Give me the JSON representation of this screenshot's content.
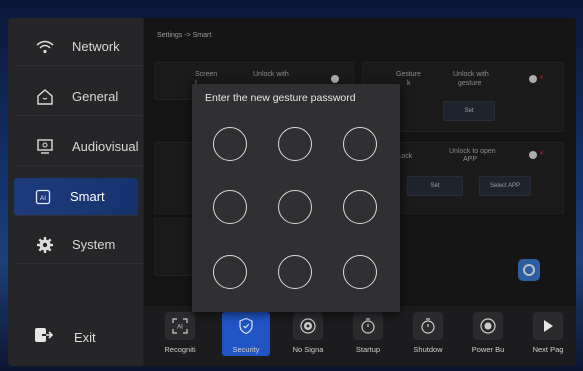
{
  "sidebar": {
    "items": [
      {
        "label": "Network",
        "icon": "wifi-icon"
      },
      {
        "label": "General",
        "icon": "home-icon"
      },
      {
        "label": "Audiovisual",
        "icon": "monitor-icon"
      },
      {
        "label": "Smart",
        "icon": "ai-icon",
        "active": true
      },
      {
        "label": "System",
        "icon": "gear-icon"
      }
    ],
    "exit_label": "Exit"
  },
  "main": {
    "breadcrumb": "Settings -> Smart",
    "screen_lock": {
      "label_a": "Screen",
      "label_b": "L",
      "option": "Unlock with"
    },
    "gesture_lock": {
      "label_a": "Gesture",
      "label_b": "k",
      "option_a": "Unlock with",
      "option_b": "gesture",
      "set_label": "Set"
    },
    "left_card_b": {
      "label": "L"
    },
    "left_card_c": {
      "label_a": "T",
      "label_b": "L"
    },
    "app_lock": {
      "label": "P Lock",
      "option_a": "Unlock to open",
      "option_b": "APP",
      "set_label": "Set",
      "select_label": "Select APP"
    }
  },
  "toolbar": {
    "items": [
      {
        "label": "Recogniti",
        "icon": "ai-scan-icon"
      },
      {
        "label": "Security",
        "icon": "shield-icon",
        "active": true
      },
      {
        "label": "No Signa",
        "icon": "no-signal-icon"
      },
      {
        "label": "Startup",
        "icon": "startup-timer-icon"
      },
      {
        "label": "Shutdow",
        "icon": "shutdown-timer-icon"
      },
      {
        "label": "Power Bu",
        "icon": "power-button-icon"
      },
      {
        "label": "Next Pag",
        "icon": "play-next-icon"
      }
    ]
  },
  "dialog": {
    "title": "Enter the new gesture password",
    "grid_rows": 3,
    "grid_cols": 3
  },
  "colors": {
    "accent": "#2155c4",
    "active_sidebar": "#1d3a7c",
    "toggle_off_x": "#dd3333",
    "fab": "#3b7fd9"
  }
}
